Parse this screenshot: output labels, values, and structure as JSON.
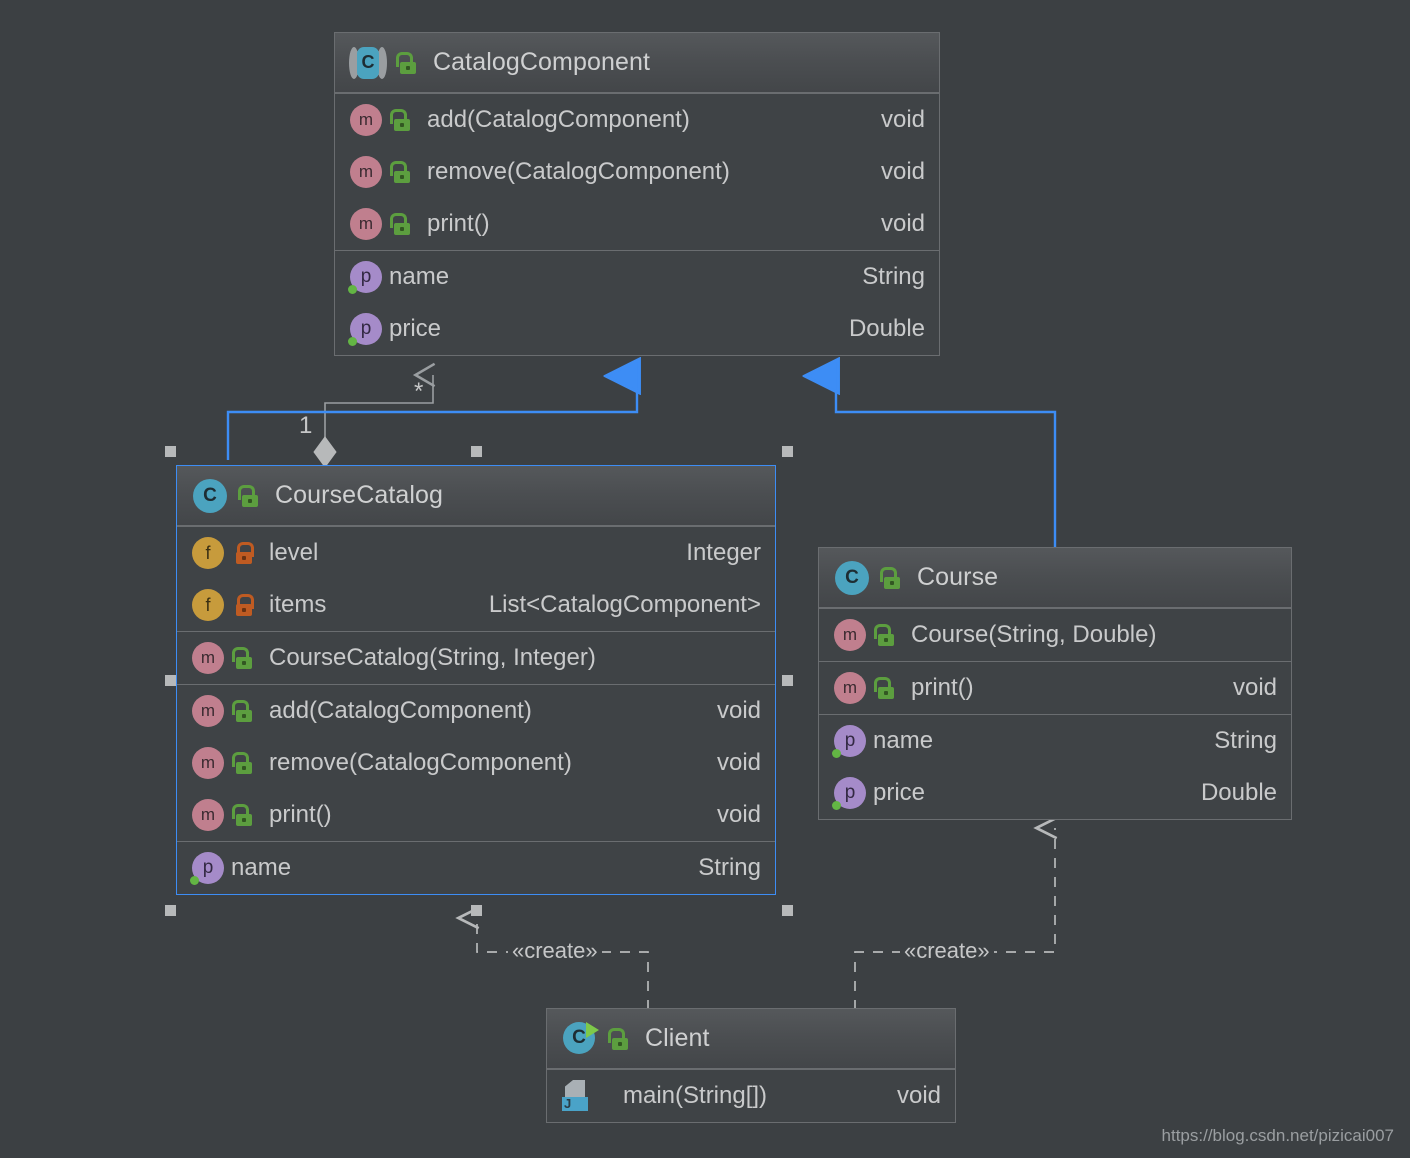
{
  "canvas": {
    "background": "#3c4043",
    "selection_color": "#3d8df5",
    "connector_color": "#9a9ea1"
  },
  "watermark": "https://blog.csdn.net/pizicai007",
  "classes": [
    {
      "id": "catalog-component",
      "name": "CatalogComponent",
      "kind_icon": "interface-icon",
      "visibility_icon": "unlock-green-icon",
      "selected": false,
      "sections": [
        {
          "rows": [
            {
              "kind_icon": "method-icon",
              "visibility_icon": "unlock-green-icon",
              "label": "add(CatalogComponent)",
              "type": "void"
            },
            {
              "kind_icon": "method-icon",
              "visibility_icon": "unlock-green-icon",
              "label": "remove(CatalogComponent)",
              "type": "void"
            },
            {
              "kind_icon": "method-icon",
              "visibility_icon": "unlock-green-icon",
              "label": "print()",
              "type": "void"
            }
          ]
        },
        {
          "rows": [
            {
              "kind_icon": "property-icon",
              "visibility_icon": "none",
              "label": "name",
              "type": "String"
            },
            {
              "kind_icon": "property-icon",
              "visibility_icon": "none",
              "label": "price",
              "type": "Double"
            }
          ]
        }
      ]
    },
    {
      "id": "course-catalog",
      "name": "CourseCatalog",
      "kind_icon": "class-icon",
      "visibility_icon": "unlock-green-icon",
      "selected": true,
      "sections": [
        {
          "rows": [
            {
              "kind_icon": "field-icon",
              "visibility_icon": "lock-orange-icon",
              "label": "level",
              "type": "Integer"
            },
            {
              "kind_icon": "field-icon",
              "visibility_icon": "lock-orange-icon",
              "label": "items",
              "type": "List<CatalogComponent>"
            }
          ]
        },
        {
          "rows": [
            {
              "kind_icon": "method-icon",
              "visibility_icon": "unlock-green-icon",
              "label": "CourseCatalog(String, Integer)",
              "type": ""
            }
          ]
        },
        {
          "rows": [
            {
              "kind_icon": "method-icon",
              "visibility_icon": "unlock-green-icon",
              "label": "add(CatalogComponent)",
              "type": "void"
            },
            {
              "kind_icon": "method-icon",
              "visibility_icon": "unlock-green-icon",
              "label": "remove(CatalogComponent)",
              "type": "void"
            },
            {
              "kind_icon": "method-icon",
              "visibility_icon": "unlock-green-icon",
              "label": "print()",
              "type": "void"
            }
          ]
        },
        {
          "rows": [
            {
              "kind_icon": "property-icon",
              "visibility_icon": "none",
              "label": "name",
              "type": "String"
            }
          ]
        }
      ]
    },
    {
      "id": "course",
      "name": "Course",
      "kind_icon": "class-icon",
      "visibility_icon": "unlock-green-icon",
      "selected": false,
      "sections": [
        {
          "rows": [
            {
              "kind_icon": "method-icon",
              "visibility_icon": "unlock-green-icon",
              "label": "Course(String, Double)",
              "type": ""
            }
          ]
        },
        {
          "rows": [
            {
              "kind_icon": "method-icon",
              "visibility_icon": "unlock-green-icon",
              "label": "print()",
              "type": "void"
            }
          ]
        },
        {
          "rows": [
            {
              "kind_icon": "property-icon",
              "visibility_icon": "none",
              "label": "name",
              "type": "String"
            },
            {
              "kind_icon": "property-icon",
              "visibility_icon": "none",
              "label": "price",
              "type": "Double"
            }
          ]
        }
      ]
    },
    {
      "id": "client",
      "name": "Client",
      "kind_icon": "runnable-class-icon",
      "visibility_icon": "unlock-green-icon",
      "selected": false,
      "sections": [
        {
          "rows": [
            {
              "kind_icon": "java-main-icon",
              "visibility_icon": "none",
              "label": "main(String[])",
              "type": "void"
            }
          ]
        }
      ]
    }
  ],
  "edges": {
    "aggregation": {
      "from": "course-catalog",
      "to": "catalog-component",
      "source_multiplicity": "1",
      "target_multiplicity": "*"
    },
    "inheritance": [
      {
        "from": "course-catalog",
        "to": "catalog-component"
      },
      {
        "from": "course",
        "to": "catalog-component"
      }
    ],
    "dependencies": [
      {
        "from": "client",
        "to": "course-catalog",
        "stereotype": "«create»"
      },
      {
        "from": "client",
        "to": "course",
        "stereotype": "«create»"
      }
    ]
  }
}
